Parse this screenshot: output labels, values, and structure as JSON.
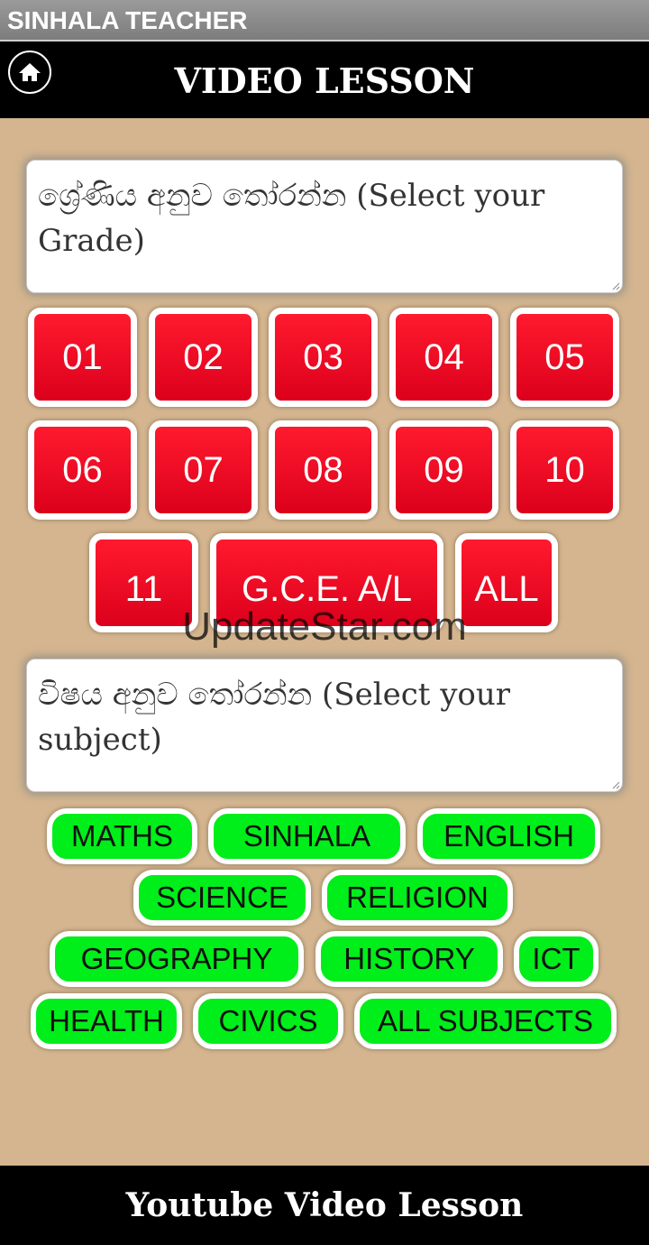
{
  "app": {
    "title": "SINHALA TEACHER"
  },
  "header": {
    "title": "VIDEO LESSON",
    "home_icon": "home-icon"
  },
  "grade_prompt": "ශ්‍රේණිය අනුව තෝරන්න (Select your Grade)",
  "grades": [
    "01",
    "02",
    "03",
    "04",
    "05",
    "06",
    "07",
    "08",
    "09",
    "10",
    "11",
    "G.C.E. A/L",
    "ALL"
  ],
  "subject_prompt": "විෂය අනුව තෝරන්න (Select your subject)",
  "subjects": [
    "MATHS",
    "SINHALA",
    "ENGLISH",
    "SCIENCE",
    "RELIGION",
    "GEOGRAPHY",
    "HISTORY",
    "ICT",
    "HEALTH",
    "CIVICS",
    "ALL SUBJECTS"
  ],
  "watermark": "UpdateStar.com",
  "footer": {
    "title": "Youtube Video Lesson"
  },
  "colors": {
    "grade_button": "#e8001e",
    "subject_button": "#00ee1a",
    "background": "#d4b58f",
    "bar": "#000000"
  }
}
